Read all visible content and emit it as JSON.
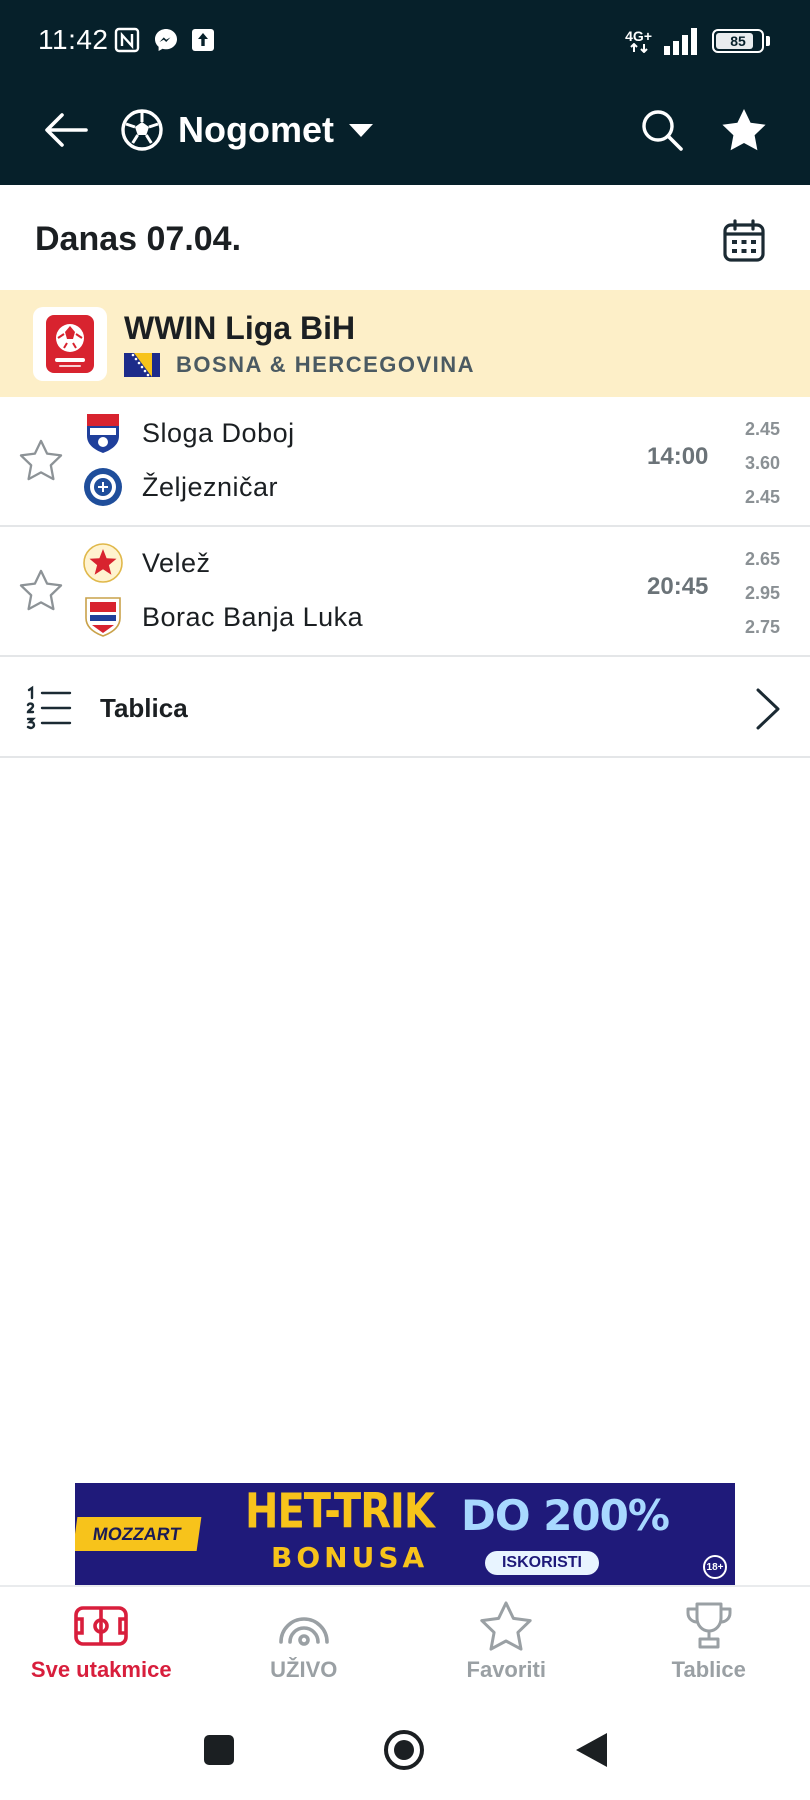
{
  "status_bar": {
    "time": "11:42",
    "network": "4G+",
    "battery": "85",
    "battery_fraction": 0.85
  },
  "app_bar": {
    "sport": "Nogomet",
    "icons": [
      "back-arrow-icon",
      "soccer-ball-icon",
      "caret-down-icon",
      "search-icon",
      "star-filled-icon"
    ]
  },
  "date_row": {
    "label": "Danas 07.04.",
    "icon": "calendar-icon"
  },
  "league": {
    "name": "WWIN Liga BiH",
    "country": "BOSNA & HERCEGOVINA"
  },
  "matches": [
    {
      "home": "Sloga Doboj",
      "away": "Željezničar",
      "time": "14:00",
      "odds": [
        "2.45",
        "3.60",
        "2.45"
      ]
    },
    {
      "home": "Velež",
      "away": "Borac Banja Luka",
      "time": "20:45",
      "odds": [
        "2.65",
        "2.95",
        "2.75"
      ]
    }
  ],
  "table_link": {
    "label": "Tablica"
  },
  "banner": {
    "brand": "MOZZART",
    "headline": "HET-TRIK",
    "subline": "BONUSA",
    "offer": "DO 200%",
    "cta": "ISKORISTI",
    "age": "18+"
  },
  "bottom_nav": [
    {
      "label": "Sve utakmice",
      "icon": "pitch-icon",
      "active": true
    },
    {
      "label": "UŽIVO",
      "icon": "live-signal-icon",
      "active": false
    },
    {
      "label": "Favoriti",
      "icon": "star-icon",
      "active": false
    },
    {
      "label": "Tablice",
      "icon": "trophy-icon",
      "active": false
    }
  ],
  "colors": {
    "header_bg": "#06202a",
    "league_bg": "#fdefc8",
    "accent": "#d81e3c",
    "banner_bg": "#1f1a7a",
    "banner_yellow": "#f7c31b"
  }
}
